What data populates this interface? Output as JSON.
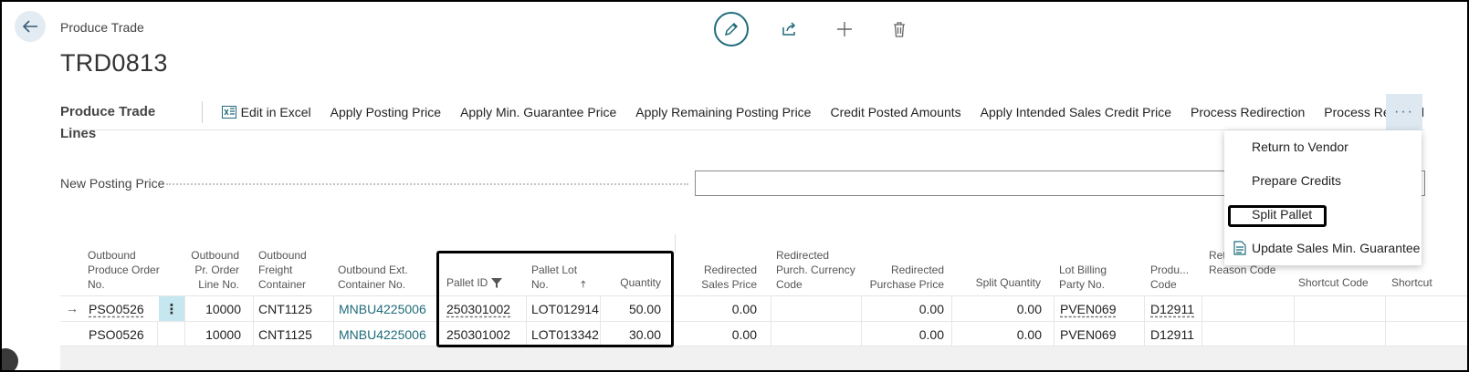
{
  "header": {
    "breadcrumb": "Produce Trade",
    "title": "TRD0813"
  },
  "top_actions": [
    "edit-icon",
    "share-icon",
    "plus-icon",
    "trash-icon"
  ],
  "lines": {
    "title": "Produce Trade Lines",
    "toolbar": [
      "Edit in Excel",
      "Apply Posting Price",
      "Apply Min. Guarantee Price",
      "Apply Remaining Posting Price",
      "Credit Posted Amounts",
      "Apply Intended Sales Credit Price",
      "Process Redirection",
      "Process Removal"
    ],
    "more": "···"
  },
  "posting": {
    "label": "New Posting Price",
    "value": ""
  },
  "dropdown": {
    "items": [
      "Return to Vendor",
      "Prepare Credits",
      "Split Pallet",
      "Update Sales Min. Guarantee"
    ]
  },
  "columns": [
    "Outbound Produce Order No.",
    "Outbound Pr. Order Line No.",
    "Outbound Freight Container",
    "Outbound Ext. Container No.",
    "Pallet ID",
    "Pallet Lot No.",
    "Quantity",
    "Redirected Sales Price",
    "Redirected Purch. Currency Code",
    "Redirected Purchase Price",
    "Split Quantity",
    "Lot Billing Party No.",
    "Produ... Code",
    "Ret... Vendor Reason Code",
    "Shortcut Code",
    "Shortcut"
  ],
  "rows": [
    {
      "order_no": "PSO0526",
      "line_no": "10000",
      "container": "CNT1125",
      "ext_container": "MNBU4225006",
      "pallet_id": "250301002",
      "lot_no": "LOT012914",
      "quantity": "50.00",
      "redirected_sales_price": "0.00",
      "redirected_purchase_price": "0.00",
      "split_quantity": "0.00",
      "billing_party": "PVEN069",
      "product_code": "D12911"
    },
    {
      "order_no": "PSO0526",
      "line_no": "10000",
      "container": "CNT1125",
      "ext_container": "MNBU4225006",
      "pallet_id": "250301002",
      "lot_no": "LOT013342",
      "quantity": "30.00",
      "redirected_sales_price": "0.00",
      "redirected_purchase_price": "0.00",
      "split_quantity": "0.00",
      "billing_party": "PVEN069",
      "product_code": "D12911"
    }
  ],
  "colors": {
    "accent": "#1f6c7a",
    "selected_menu": "#c6e7ef",
    "more_button_bg": "#dde8f0"
  }
}
